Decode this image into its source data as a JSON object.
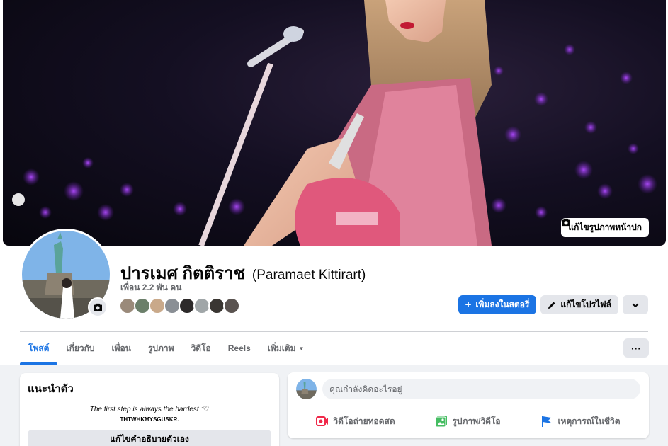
{
  "cover": {
    "edit_label": "แก้ไขรูปภาพหน้าปก"
  },
  "profile": {
    "name": "ปารเมศ กิตติราช",
    "name_alt": "(Paramaet Kittirart)",
    "friend_count": "เพื่อน 2.2 พัน คน",
    "friend_avatar_count": 8
  },
  "actions": {
    "add_story": "เพิ่มลงในสตอรี่",
    "edit_profile": "แก้ไขโปรไฟล์"
  },
  "tabs": [
    {
      "label": "โพสต์",
      "active": true
    },
    {
      "label": "เกี่ยวกับ"
    },
    {
      "label": "เพื่อน"
    },
    {
      "label": "รูปภาพ"
    },
    {
      "label": "วิดีโอ"
    },
    {
      "label": "Reels"
    },
    {
      "label": "เพิ่มเติม"
    }
  ],
  "more_label": "···",
  "intro": {
    "title": "แนะนำตัว",
    "bio_line1": "The first step is always the hardest :♡",
    "bio_line2": "THTWHKMYSGUSKR.",
    "edit_bio": "แก้ไขคำอธิบายตัวเอง"
  },
  "composer": {
    "placeholder": "คุณกำลังคิดอะไรอยู่",
    "live_video": "วิดีโอถ่ายทอดสด",
    "photo_video": "รูปภาพ/วิดีโอ",
    "life_event": "เหตุการณ์ในชีวิต"
  },
  "colors": {
    "accent": "#1b74e4",
    "live_red": "#f02849",
    "photo_green": "#45bd62",
    "event_blue": "#1b74e4"
  }
}
